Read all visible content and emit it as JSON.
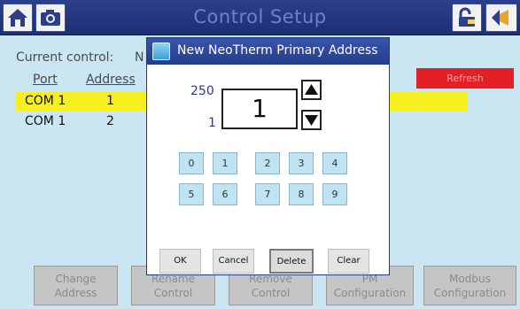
{
  "header": {
    "title": "Control Setup"
  },
  "main": {
    "current_control_label": "Current control:",
    "current_control_value": "N",
    "columns": {
      "port": "Port",
      "address": "Address"
    },
    "rows": [
      {
        "port": "COM 1",
        "address": "1",
        "selected": true
      },
      {
        "port": "COM 1",
        "address": "2",
        "selected": false
      }
    ],
    "refresh_label": "Refresh"
  },
  "bottom_buttons": [
    {
      "line1": "Change",
      "line2": "Address"
    },
    {
      "line1": "Rename",
      "line2": "Control"
    },
    {
      "line1": "Remove",
      "line2": "Control"
    },
    {
      "line1": "PM",
      "line2": "Configuration"
    },
    {
      "line1": "Modbus",
      "line2": "Configuration"
    }
  ],
  "dialog": {
    "title": "New NeoTherm Primary Address",
    "max": "250",
    "min": "1",
    "value": "1",
    "keys_row1": [
      "0",
      "1",
      "2",
      "3",
      "4"
    ],
    "keys_row2": [
      "5",
      "6",
      "7",
      "8",
      "9"
    ],
    "buttons": {
      "ok": "OK",
      "cancel": "Cancel",
      "delete": "Delete",
      "clear": "Clear"
    }
  },
  "colors": {
    "titlebar": "#2b3f8c",
    "background": "#c9e6f2",
    "selection": "#f5ee20",
    "refresh": "#e41f26"
  },
  "icons": {
    "home": "home-icon",
    "camera": "camera-icon",
    "lock": "lock-icon",
    "back": "back-arrow-icon"
  }
}
